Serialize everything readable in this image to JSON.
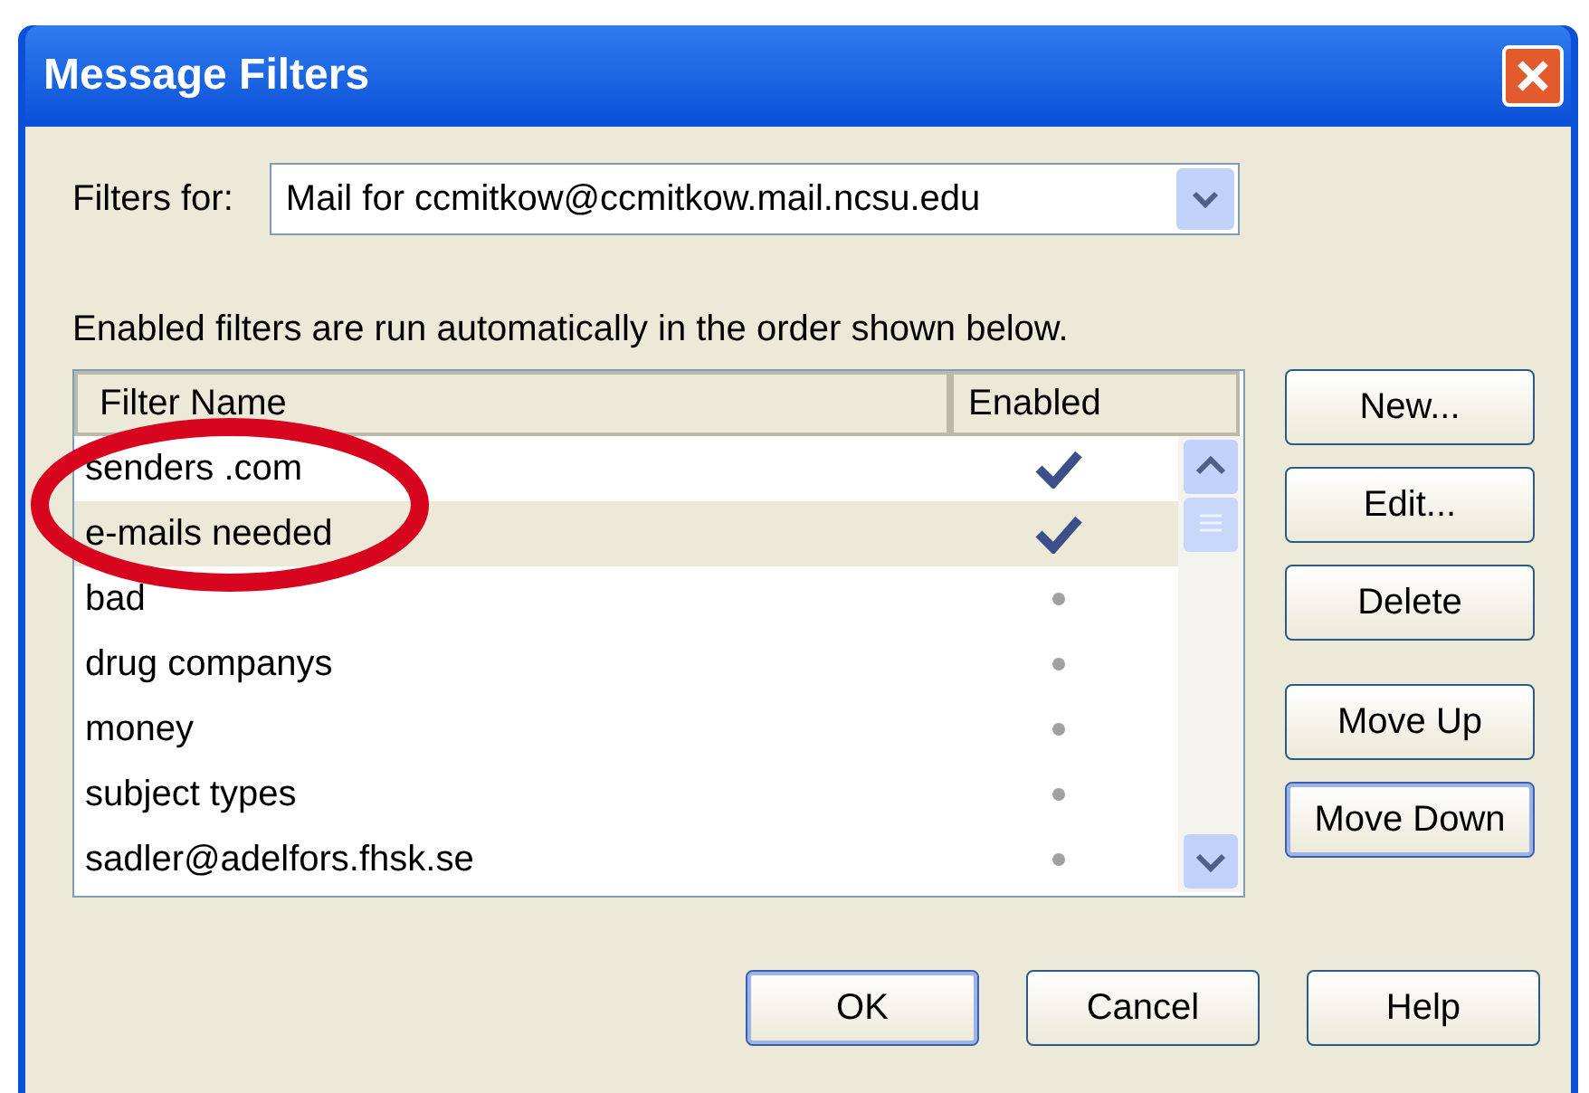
{
  "window": {
    "title": "Message Filters"
  },
  "filters_for": {
    "label": "Filters for:",
    "value": "Mail for ccmitkow@ccmitkow.mail.ncsu.edu"
  },
  "description": "Enabled filters are run automatically in the order shown below.",
  "table": {
    "columns": [
      "Filter Name",
      "Enabled"
    ],
    "rows": [
      {
        "name": "senders .com",
        "enabled": true,
        "selected": false
      },
      {
        "name": "e-mails needed",
        "enabled": true,
        "selected": true
      },
      {
        "name": "bad",
        "enabled": false,
        "selected": false
      },
      {
        "name": "drug companys",
        "enabled": false,
        "selected": false
      },
      {
        "name": "money",
        "enabled": false,
        "selected": false
      },
      {
        "name": "subject types",
        "enabled": false,
        "selected": false
      },
      {
        "name": "sadler@adelfors.fhsk.se",
        "enabled": false,
        "selected": false
      }
    ]
  },
  "side_buttons": [
    {
      "label": "New...",
      "focused": false
    },
    {
      "label": "Edit...",
      "focused": false
    },
    {
      "label": "Delete",
      "focused": false
    },
    {
      "label": "Move Up",
      "focused": false
    },
    {
      "label": "Move Down",
      "focused": true
    }
  ],
  "footer_buttons": [
    {
      "label": "OK",
      "focused": true
    },
    {
      "label": "Cancel",
      "focused": false
    },
    {
      "label": "Help",
      "focused": false
    }
  ]
}
